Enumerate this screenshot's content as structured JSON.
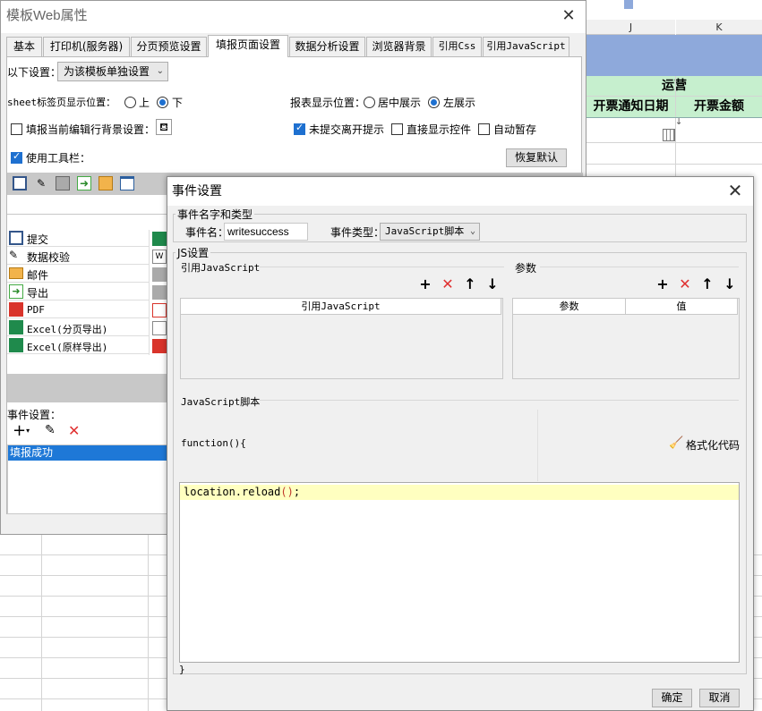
{
  "sheet": {
    "columns": [
      "J",
      "K"
    ],
    "group_header": "运营",
    "headers": [
      "开票通知日期",
      "开票金额"
    ],
    "colors": {
      "blue_bar": "#8ea9db",
      "green_header": "#c6efce"
    }
  },
  "web_window": {
    "title": "模板Web属性",
    "tabs": [
      "基本",
      "打印机(服务器)",
      "分页预览设置",
      "填报页面设置",
      "数据分析设置",
      "浏览器背景",
      "引用Css",
      "引用JavaScript"
    ],
    "active_tab": "填报页面设置",
    "settings_label": "以下设置：",
    "settings_select": "为该模板单独设置",
    "sheet_tab_label": "sheet标签页显示位置：",
    "sheet_tab_options": [
      "上",
      "下"
    ],
    "sheet_tab_selected": "下",
    "report_pos_label": "报表显示位置：",
    "report_pos_options": [
      "居中展示",
      "左展示"
    ],
    "report_pos_selected": "左展示",
    "bg_setting_label": "填报当前编辑行背景设置：",
    "unsubmitted_prompt": "未提交离开提示",
    "direct_show_control": "直接显示控件",
    "auto_save": "自动暂存",
    "use_toolbar": "使用工具栏：",
    "restore_default": "恢复默认",
    "toolbar_items": [
      "提交",
      "数据校验",
      "邮件",
      "导出",
      "PDF",
      "Excel(分页导出)",
      "Excel(原样导出)"
    ],
    "event_settings_label": "事件设置：",
    "events": [
      "填报成功"
    ]
  },
  "event_dialog": {
    "title": "事件设置",
    "name_type_group": "事件名字和类型",
    "event_name_label": "事件名：",
    "event_name_value": "writesuccess",
    "event_type_label": "事件类型：",
    "event_type_value": "JavaScript脚本",
    "js_group": "JS设置",
    "ref_js_label": "引用JavaScript",
    "ref_js_col": "引用JavaScript",
    "params_label": "参数",
    "param_cols": [
      "参数",
      "值"
    ],
    "script_label": "JavaScript脚本",
    "func_header": "function(){",
    "format_code": "格式化代码",
    "code_text": "location.reload",
    "code_parens": "()",
    "code_semicolon": ";",
    "func_footer": "}",
    "ok_button": "确定",
    "cancel_button": "取消"
  }
}
